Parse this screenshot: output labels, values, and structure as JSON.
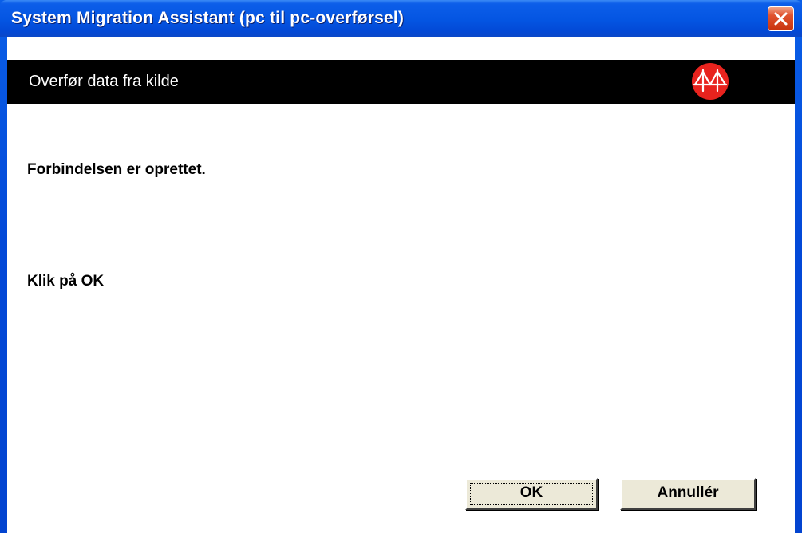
{
  "window": {
    "title": "System Migration Assistant (pc til pc-overførsel)"
  },
  "header": {
    "text": "Overfør data fra kilde"
  },
  "messages": {
    "status": "Forbindelsen er oprettet.",
    "instruction": "Klik på OK"
  },
  "buttons": {
    "ok_label": "OK",
    "cancel_label": "Annullér"
  },
  "icons": {
    "close": "close-icon",
    "logo": "bridge-logo-icon"
  },
  "colors": {
    "titlebar": "#0455e2",
    "header_band": "#000000",
    "logo": "#e8231e",
    "button_face": "#ece9d8"
  }
}
